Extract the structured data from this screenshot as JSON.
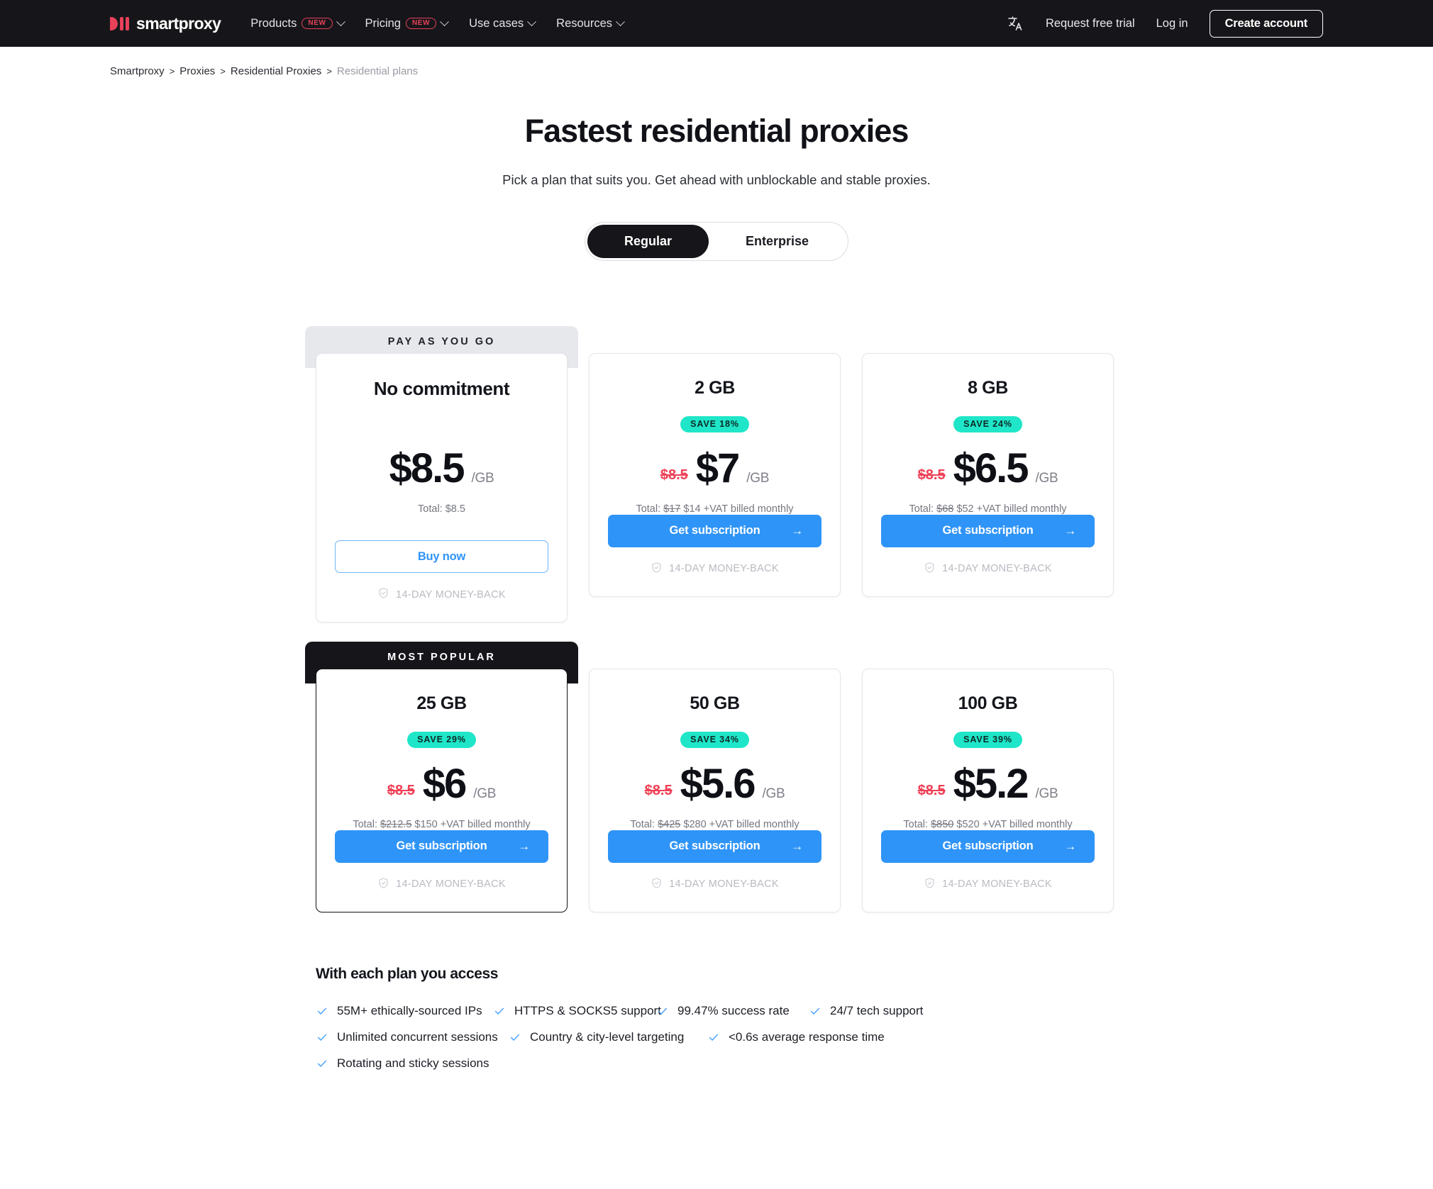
{
  "nav": {
    "brand": "smartproxy",
    "items": [
      {
        "label": "Products",
        "badge": "NEW",
        "has_chevron": true
      },
      {
        "label": "Pricing",
        "badge": "NEW",
        "has_chevron": true
      },
      {
        "label": "Use cases",
        "badge": null,
        "has_chevron": true
      },
      {
        "label": "Resources",
        "badge": null,
        "has_chevron": true
      }
    ],
    "language_icon": "translate-icon",
    "request_trial": "Request free trial",
    "log_in": "Log in",
    "create_account": "Create account"
  },
  "breadcrumb": {
    "items": [
      {
        "label": "Smartproxy",
        "current": false
      },
      {
        "label": "Proxies",
        "current": false
      },
      {
        "label": "Residential Proxies",
        "current": false
      },
      {
        "label": "Residential plans",
        "current": true
      }
    ],
    "separator": ">"
  },
  "hero": {
    "title": "Fastest residential proxies",
    "subtitle": "Pick a plan that suits you. Get ahead with unblockable and stable proxies."
  },
  "toggle": {
    "options": [
      "Regular",
      "Enterprise"
    ],
    "selected": "Regular"
  },
  "plans": [
    {
      "ribbon": "PAY AS YOU GO",
      "ribbon_style": "gray",
      "title": "No commitment",
      "save_badge": null,
      "old_price": null,
      "price": "$8.5",
      "unit": "/GB",
      "total_prefix": "Total:",
      "total_old": null,
      "total_new": "$8.5",
      "total_suffix": "",
      "cta": "Buy now",
      "cta_style": "outline",
      "cta_arrow": false,
      "guarantee": "14-DAY MONEY-BACK",
      "highlight": false
    },
    {
      "ribbon": null,
      "ribbon_style": null,
      "title": "2 GB",
      "save_badge": "SAVE 18%",
      "old_price": "$8.5",
      "price": "$7",
      "unit": "/GB",
      "total_prefix": "Total:",
      "total_old": "$17",
      "total_new": "$14",
      "total_suffix": "+VAT billed monthly",
      "cta": "Get subscription",
      "cta_style": "primary",
      "cta_arrow": true,
      "guarantee": "14-DAY MONEY-BACK",
      "highlight": false
    },
    {
      "ribbon": null,
      "ribbon_style": null,
      "title": "8 GB",
      "save_badge": "SAVE 24%",
      "old_price": "$8.5",
      "price": "$6.5",
      "unit": "/GB",
      "total_prefix": "Total:",
      "total_old": "$68",
      "total_new": "$52",
      "total_suffix": "+VAT billed monthly",
      "cta": "Get subscription",
      "cta_style": "primary",
      "cta_arrow": true,
      "guarantee": "14-DAY MONEY-BACK",
      "highlight": false
    },
    {
      "ribbon": "MOST POPULAR",
      "ribbon_style": "dark",
      "title": "25 GB",
      "save_badge": "SAVE 29%",
      "old_price": "$8.5",
      "price": "$6",
      "unit": "/GB",
      "total_prefix": "Total:",
      "total_old": "$212.5",
      "total_new": "$150",
      "total_suffix": "+VAT billed monthly",
      "cta": "Get subscription",
      "cta_style": "primary",
      "cta_arrow": true,
      "guarantee": "14-DAY MONEY-BACK",
      "highlight": true
    },
    {
      "ribbon": null,
      "ribbon_style": null,
      "title": "50 GB",
      "save_badge": "SAVE 34%",
      "old_price": "$8.5",
      "price": "$5.6",
      "unit": "/GB",
      "total_prefix": "Total:",
      "total_old": "$425",
      "total_new": "$280",
      "total_suffix": "+VAT billed monthly",
      "cta": "Get subscription",
      "cta_style": "primary",
      "cta_arrow": true,
      "guarantee": "14-DAY MONEY-BACK",
      "highlight": false
    },
    {
      "ribbon": null,
      "ribbon_style": null,
      "title": "100 GB",
      "save_badge": "SAVE 39%",
      "old_price": "$8.5",
      "price": "$5.2",
      "unit": "/GB",
      "total_prefix": "Total:",
      "total_old": "$850",
      "total_new": "$520",
      "total_suffix": "+VAT billed monthly",
      "cta": "Get subscription",
      "cta_style": "primary",
      "cta_arrow": true,
      "guarantee": "14-DAY MONEY-BACK",
      "highlight": false
    }
  ],
  "features": {
    "heading": "With each plan you access",
    "rows": [
      [
        "55M+ ethically-sourced IPs",
        "HTTPS & SOCKS5 support",
        "99.47% success rate",
        "24/7 tech support"
      ],
      [
        "Unlimited concurrent sessions",
        "Country & city-level targeting",
        "<0.6s average response time"
      ],
      [
        "Rotating and sticky sessions"
      ]
    ]
  },
  "colors": {
    "accent_blue": "#2f94f7",
    "brand_red": "#e8415a",
    "save_teal": "#1fe6c8",
    "old_price_red": "#ef4056",
    "nav_dark": "#16161a"
  }
}
